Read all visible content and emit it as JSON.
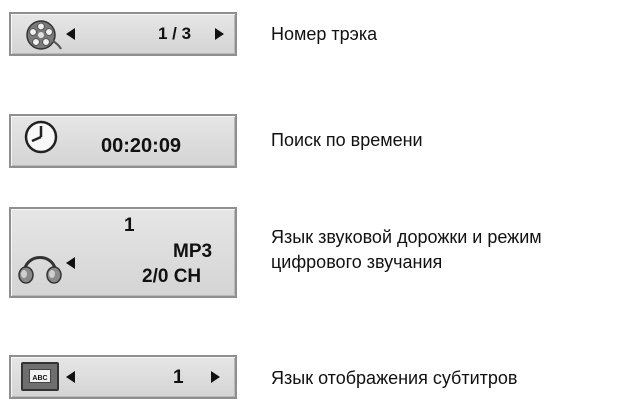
{
  "rows": [
    {
      "icon": "film-reel-icon",
      "value": "1 / 3",
      "caption": "Номер трэка"
    },
    {
      "icon": "clock-icon",
      "value": "00:20:09",
      "caption": "Поиск по времени"
    },
    {
      "icon": "headphones-icon",
      "value_lines": [
        "1",
        "MP3",
        "2/0 CH"
      ],
      "caption_lines": [
        "Язык звуковой дорожки и режим",
        "цифрового звучания"
      ]
    },
    {
      "icon": "subtitle-abc-icon",
      "icon_label": "ABC",
      "value": "1",
      "caption": "Язык отображения субтитров"
    }
  ]
}
